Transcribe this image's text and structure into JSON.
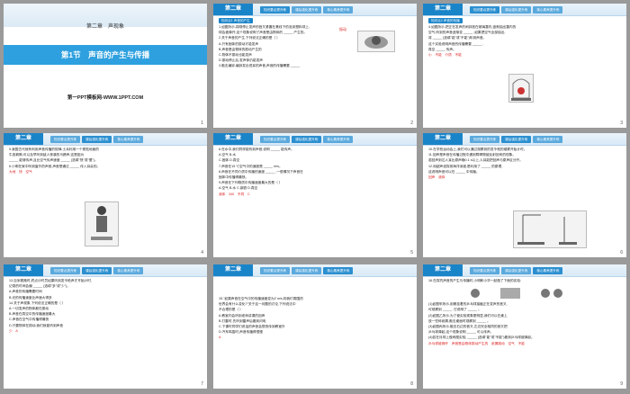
{
  "window": {
    "title": "第二章 声现象 第1节 声音的产生与传播 PPT 缩略图"
  },
  "header": {
    "chapter_label": "第二章",
    "tabs": [
      "知识要点提升练",
      "课后强化提升练",
      "核心素养提升练"
    ]
  },
  "slides": [
    {
      "page": "1",
      "chapter_title": "第二章　声现象",
      "lesson_title": "第1节　声音的产生与传播",
      "site": "第一PPT模板网-WWW.1PPT.COM"
    },
    {
      "page": "2",
      "section": "知识点1 声音的产生",
      "lines": [
        "1.如图所示,将刚停止发声的音叉紧靠在悬线下的泡沫塑料球上,",
        "球会被弹开,这个现象说明了声音是由物体的 _____ 产生的。",
        "2.关于声音的产生,下列说法正确的是（  ）",
        "A.只有固体的振动才能发声",
        "B.声音是由物体的振动产生的",
        "C.物体不振动也能发声",
        "D.振动停止后,发声体仍能发声",
        "3.敲击编钟,编钟发出悦耳的声音,声音的传播需要 _____"
      ],
      "answer": "振动"
    },
    {
      "page": "3",
      "section": "知识点2 声音的传播",
      "lines": [
        "4.如图所示,把正在发声的闹钟放在玻璃罩内,逐渐抽出罩内的",
        "空气,听到的声音逐渐变 _____ ;如果把空气全部抽出,",
        "将 _____ (选填\"能\"或\"不能\")听到声音。",
        "这个实验说明声音的传播需要 _____ ,",
        "真空 _____ 传声。"
      ],
      "answers": [
        "小",
        "不能",
        "介质",
        "不能"
      ]
    },
    {
      "page": "4",
      "lines": [
        "5.我国古代就有利用声音传播的规律,士兵利用一个紧贴地面的",
        "牛皮箭筒,可以及早听到敌人夜袭的马蹄声,这是因为",
        "_____ 能够传声,且比空气传声速度 _____ (选填\"快\"或\"慢\")。",
        "6.小明在家中听到窗外的声音,声音是通过 _____ 传入耳朵的。"
      ],
      "answers": [
        "大地",
        "快",
        "空气"
      ]
    },
    {
      "page": "5",
      "lines": [
        "6.在水中,我们同样能听到声音,说明 _____ 能传声。",
        "A.空气  B.水",
        "C.固体  D.真空",
        "7.声音在15 ℃空气中的速度是 _____ m/s。",
        "8.声音在不同介质中传播的速度 _____ ,一般情况下声音在",
        "固体中传播得最快。",
        "9.声音在下列物质中传播速度最大的是（  ）",
        "A.空气  B.水  C.钢铁  D.真空"
      ],
      "answers": [
        "液体",
        "340",
        "不同",
        "C"
      ]
    },
    {
      "page": "6",
      "lines": [
        "10.在学校运动会上,我们可以通过观察到的发令枪的烟雾开始计时。",
        "11.回声是声音在传播过程中遇到障碍物被反射回来的现象。",
        "若回声到达人耳比原声晚0.1 s以上,人耳能把回声与原声区分开。",
        "12.用超声波探测海洋深度,是利用了 _____ 的原理,",
        "这说明声音可以在 _____ 中传播。"
      ],
      "answers": [
        "回声",
        "液体"
      ]
    },
    {
      "page": "7",
      "lines": [
        "13.百米赛跑时,终点计时员如果听到发令枪声才开始计时,",
        "记录的时间会偏 _____ (选填\"多\"或\"少\")。",
        "A.声音的传播需要时间",
        "B.光的传播速度比声速大得多",
        "14.关于声现象,下列说法正确的是（  ）",
        "A.一切发声的物体都在振动",
        "B.声音在真空中的传播速度最大",
        "C.声音在空气中传播得最快",
        "D.只要物体在振动,我们就能听到声音"
      ],
      "answers": [
        "少",
        "A"
      ]
    },
    {
      "page": "8",
      "lines": [
        "15.\"如果声音在空气中的传播速度变为2 m/s,则我们周围的",
        "世界会有什么变化?\"关于这一问题的讨论,下列说法中",
        "不合理的是（  ）",
        "A.教室内会听到老师讲课的回声",
        "B.打雷时,先听到雷声后看到闪电",
        "C.下课时同学们说话的声音会很快传到教室外",
        "D.汽车鸣笛时,声音传播得很慢"
      ],
      "answers": [
        "A"
      ]
    },
    {
      "page": "9",
      "lines": [
        "16.在探究声音的产生与传播时,小明和小华一起做了下面的实验:",
        "(1)如图甲所示,用悬挂着的乒乓球接触正在发声的音叉,",
        "可观察到 _____ ,它说明了 _____ 。",
        "(2)如图乙所示,为了使实验现象更明显,我们可以在桌上",
        "放一些碎纸屑,敲击桌面时观察到 _____ 。",
        "(3)如图丙所示,敲击右边的音叉,左边完全相同的音叉把",
        "乒乓球弹起,这个现象说明 _____ 可以传声。",
        "(4)若在月球上做丙图实验, _____ (选填\"能\"或\"不能\")看到乒乓球被弹起。"
      ],
      "answers": [
        "乒乓球被弹开",
        "声音是由物体振动产生的",
        "纸屑跳动",
        "空气",
        "不能"
      ]
    }
  ],
  "colors": {
    "accent": "#1a84c9",
    "band": "#2ea0df",
    "answer": "#d22222",
    "background": "#9a9a9a"
  }
}
